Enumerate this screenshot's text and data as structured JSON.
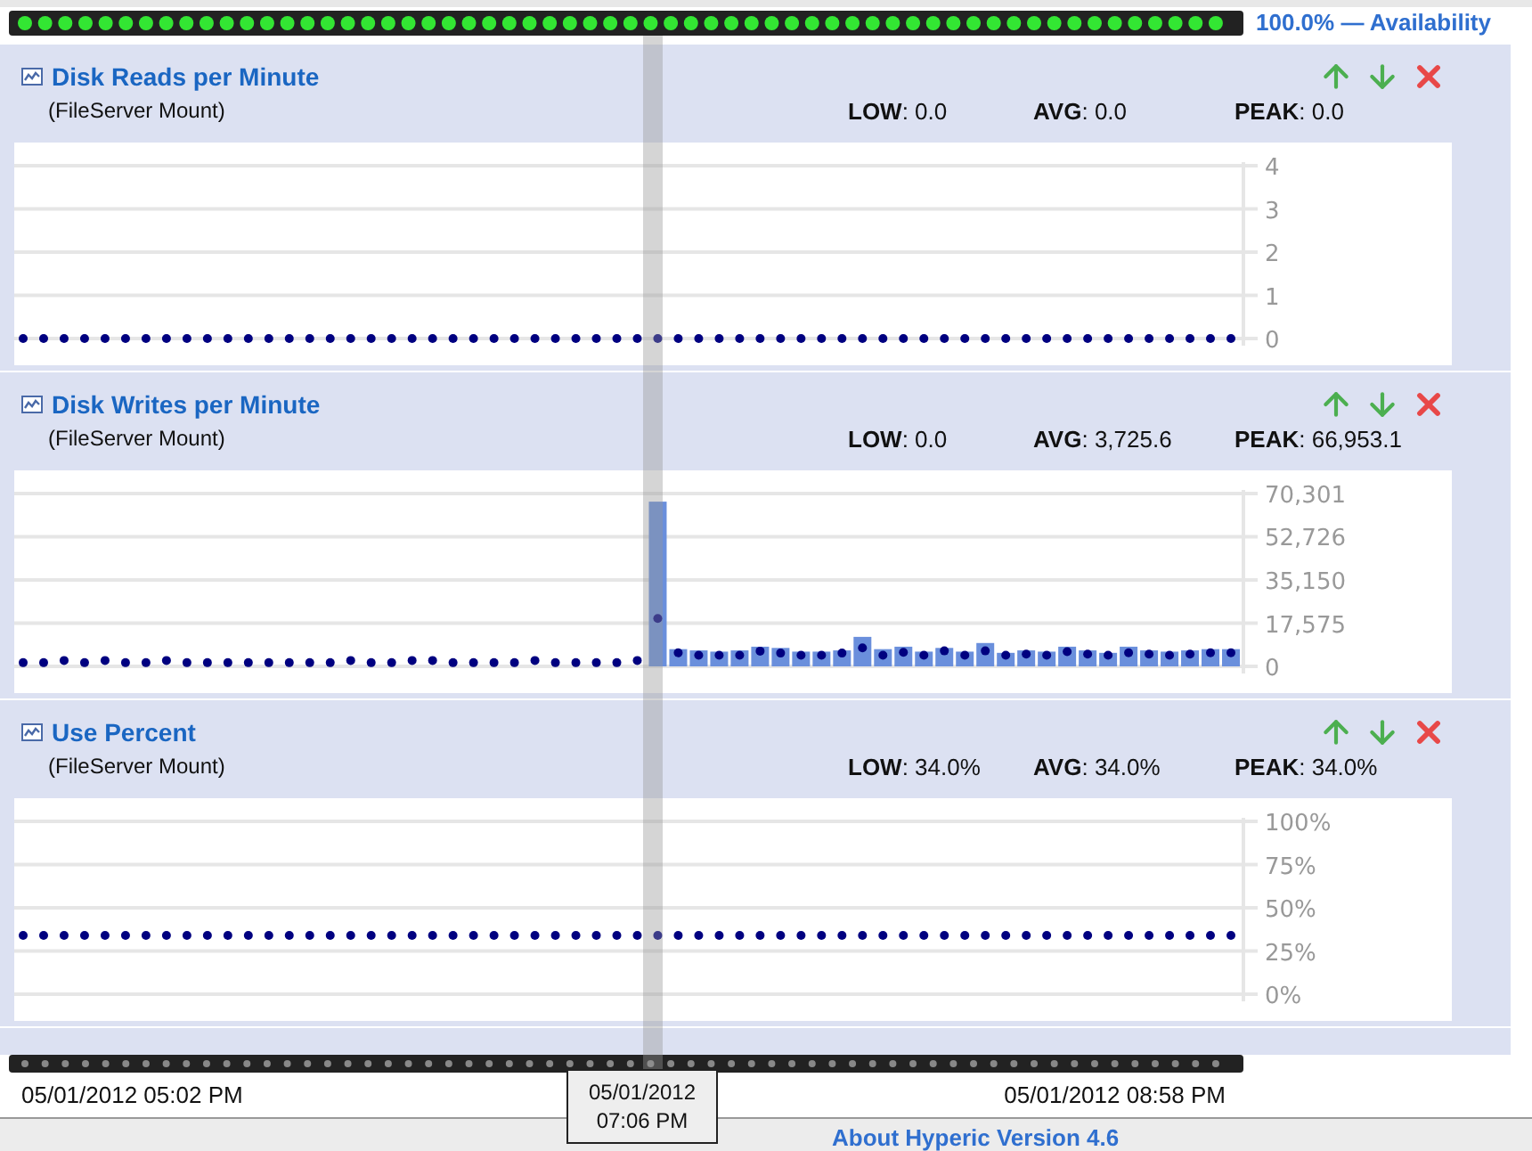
{
  "availability": {
    "text": "100.0% — Availability"
  },
  "metrics": [
    {
      "title": "Disk Reads per Minute",
      "subtitle": "(FileServer Mount)",
      "stats": [
        "**LOW**: 0.0",
        "**AVG**: 0.0",
        "**PEAK**: 0.0"
      ],
      "chart_data": {
        "type": "scatter",
        "grid": true,
        "ylim": [
          0,
          4
        ],
        "yticks": [
          0,
          1,
          2,
          3,
          4
        ],
        "series": [
          {
            "color": "#000080",
            "values": [
              0,
              0,
              0,
              0,
              0,
              0,
              0,
              0,
              0,
              0,
              0,
              0,
              0,
              0,
              0,
              0,
              0,
              0,
              0,
              0,
              0,
              0,
              0,
              0,
              0,
              0,
              0,
              0,
              0,
              0,
              0,
              0,
              0,
              0,
              0,
              0,
              0,
              0,
              0,
              0,
              0,
              0,
              0,
              0,
              0,
              0,
              0,
              0,
              0,
              0,
              0,
              0,
              0,
              0,
              0,
              0,
              0,
              0,
              0,
              0
            ]
          }
        ]
      }
    },
    {
      "title": "Disk Writes per Minute",
      "subtitle": "(FileServer Mount)",
      "stats": [
        "**LOW**: 0.0",
        "**AVG**: 3,725.6",
        "**PEAK**: 66,953.1"
      ],
      "chart_data": {
        "type": "scatter",
        "grid": true,
        "ylim": [
          0,
          70301
        ],
        "yticks": [
          {
            "value": 0,
            "label": "0"
          },
          {
            "value": 17575,
            "label": "17,575"
          },
          {
            "value": 35150,
            "label": "35,150"
          },
          {
            "value": 52726,
            "label": "52,726"
          },
          {
            "value": 70301,
            "label": "70,301"
          }
        ],
        "series": [
          {
            "type": "bar",
            "color": "#6a8fdc",
            "values": [
              null,
              null,
              null,
              null,
              null,
              null,
              null,
              null,
              null,
              null,
              null,
              null,
              null,
              null,
              null,
              null,
              null,
              null,
              null,
              null,
              null,
              null,
              null,
              null,
              null,
              null,
              null,
              null,
              null,
              null,
              null,
              67000,
              7000,
              6500,
              6000,
              6500,
              8000,
              7500,
              6000,
              6000,
              6500,
              12000,
              7000,
              8000,
              6000,
              7500,
              6000,
              9500,
              5500,
              6500,
              6000,
              8000,
              6500,
              5500,
              8000,
              6500,
              6000,
              6500,
              7000,
              7000
            ]
          },
          {
            "color": "#000080",
            "values": [
              1500,
              1500,
              2400,
              1500,
              2400,
              1500,
              1500,
              2400,
              1500,
              1500,
              1500,
              1500,
              1500,
              1500,
              1500,
              1500,
              2400,
              1500,
              1500,
              2400,
              2400,
              1500,
              1500,
              1500,
              1500,
              2400,
              1500,
              1500,
              1500,
              1500,
              2400,
              19500,
              5500,
              4500,
              4500,
              4500,
              6200,
              5400,
              4500,
              4500,
              5400,
              7500,
              4500,
              5700,
              4500,
              6300,
              4500,
              6300,
              4500,
              5000,
              4500,
              6000,
              5000,
              4500,
              5500,
              5000,
              4500,
              5000,
              5500,
              5500
            ]
          }
        ]
      }
    },
    {
      "title": "Use Percent",
      "subtitle": "(FileServer Mount)",
      "stats": [
        "**LOW**: 34.0%",
        "**AVG**: 34.0%",
        "**PEAK**: 34.0%"
      ],
      "chart_data": {
        "type": "scatter",
        "grid": true,
        "ylim": [
          0,
          100
        ],
        "yticks": [
          {
            "value": 0,
            "label": "0%"
          },
          {
            "value": 25,
            "label": "25%"
          },
          {
            "value": 50,
            "label": "50%"
          },
          {
            "value": 75,
            "label": "75%"
          },
          {
            "value": 100,
            "label": "100%"
          }
        ],
        "series": [
          {
            "color": "#000080",
            "values": [
              34,
              34,
              34,
              34,
              34,
              34,
              34,
              34,
              34,
              34,
              34,
              34,
              34,
              34,
              34,
              34,
              34,
              34,
              34,
              34,
              34,
              34,
              34,
              34,
              34,
              34,
              34,
              34,
              34,
              34,
              34,
              34,
              34,
              34,
              34,
              34,
              34,
              34,
              34,
              34,
              34,
              34,
              34,
              34,
              34,
              34,
              34,
              34,
              34,
              34,
              34,
              34,
              34,
              34,
              34,
              34,
              34,
              34,
              34,
              34
            ]
          }
        ]
      }
    }
  ],
  "timeline": {
    "start": "05/01/2012 05:02 PM",
    "end": "05/01/2012 08:58 PM",
    "tooltip": [
      "05/01/2012",
      "07:06 PM"
    ]
  },
  "footer": {
    "link": "About Hyperic Version 4.6"
  }
}
